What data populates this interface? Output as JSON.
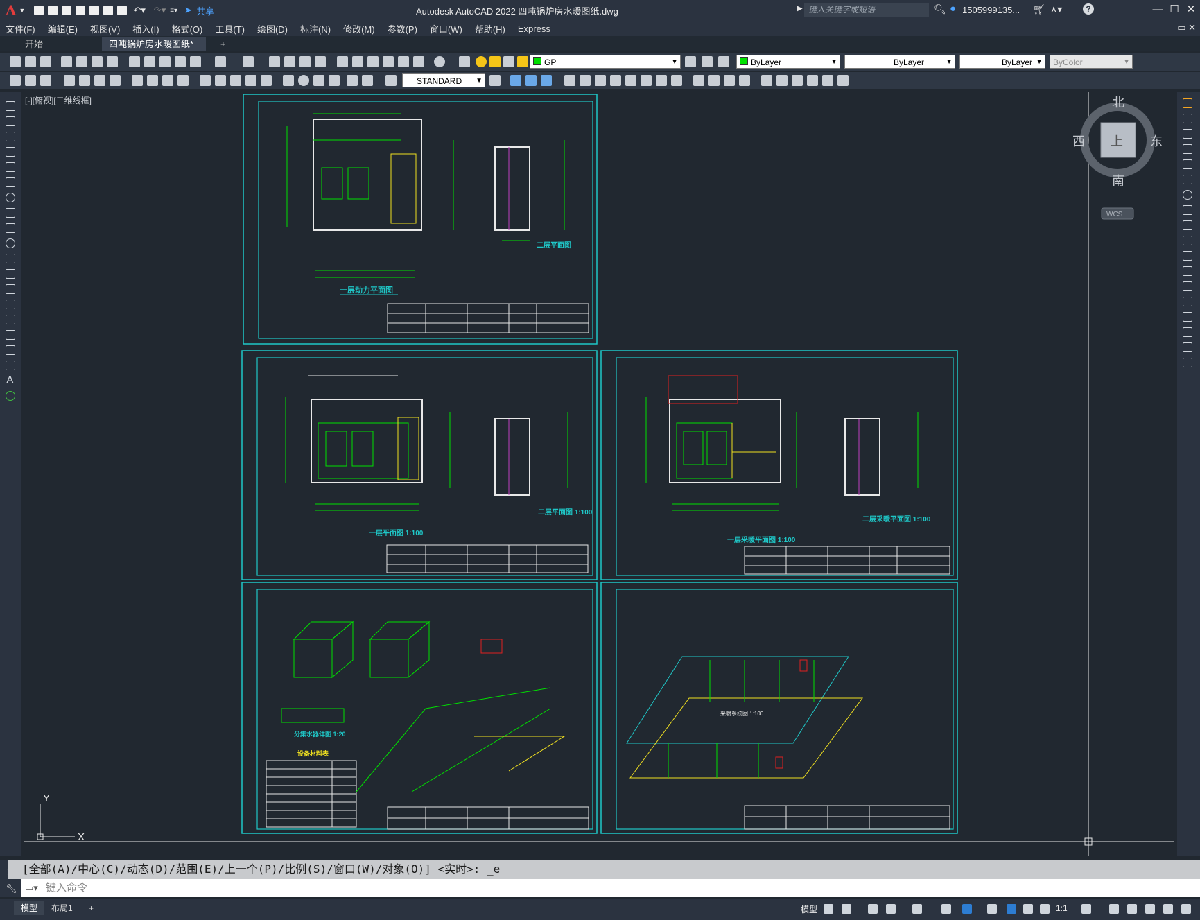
{
  "titlebar": {
    "app_logo": "A",
    "share_label": "共享",
    "title": "Autodesk AutoCAD 2022    四吨锅炉房水暖图纸.dwg",
    "search_placeholder": "键入关键字或短语",
    "user": "1505999135..."
  },
  "menubar": {
    "items": [
      "文件(F)",
      "编辑(E)",
      "视图(V)",
      "插入(I)",
      "格式(O)",
      "工具(T)",
      "绘图(D)",
      "标注(N)",
      "修改(M)",
      "参数(P)",
      "窗口(W)",
      "帮助(H)",
      "Express"
    ]
  },
  "tabs": {
    "start": "开始",
    "drawing": "四吨锅炉房水暖图纸*",
    "close": "✕",
    "add": "+"
  },
  "toolbar": {
    "layer": "GP",
    "color": "ByLayer",
    "linetype": "ByLayer",
    "lineweight": "ByLayer",
    "plotstyle": "ByColor",
    "text_style": "STANDARD"
  },
  "viewport": {
    "label": "[-][俯视][二维线框]"
  },
  "viewcube": {
    "north": "北",
    "south": "南",
    "east": "东",
    "west": "西",
    "face": "上",
    "wcs": "WCS"
  },
  "ucs": {
    "x": "X",
    "y": "Y"
  },
  "sheets": {
    "s1_title": "一层动力平面图",
    "s1_sub": "二层平面图",
    "s2_title": "一层平面图 1:100",
    "s2_sub": "二层平面图 1:100",
    "s3_title": "一层采暖平面图 1:100",
    "s3_sub": "二层采暖平面图 1:100",
    "s4_title1": "分集水器详图 1:20",
    "s4_title2": "设备材料表",
    "s5_title": "采暖系统图 1:100"
  },
  "command": {
    "history": "[全部(A)/中心(C)/动态(D)/范围(E)/上一个(P)/比例(S)/窗口(W)/对象(O)] <实时>: _e",
    "placeholder": "键入命令"
  },
  "statusbar": {
    "model_tab": "模型",
    "layout_tab": "布局1",
    "add_tab": "+",
    "model_label": "模型",
    "scale": "1:1"
  }
}
